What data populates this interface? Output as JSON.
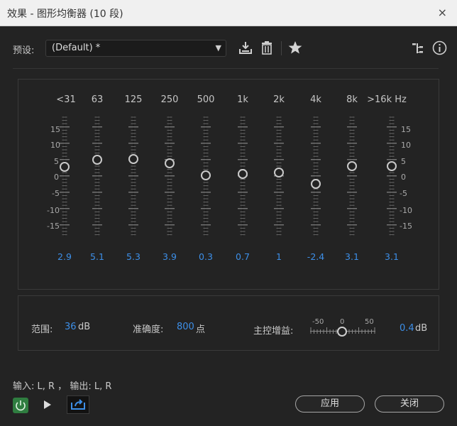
{
  "window": {
    "title": "效果 - 图形均衡器 (10 段)",
    "close_glyph": "×"
  },
  "preset": {
    "label": "预设:",
    "value": "(Default) *"
  },
  "toolbar_icons": [
    "save-preset-icon",
    "delete-icon",
    "favorite-star-icon",
    "routing-icon",
    "info-icon"
  ],
  "eq": {
    "bands": [
      "<31",
      "63",
      "125",
      "250",
      "500",
      "1k",
      "2k",
      "4k",
      "8k",
      ">16k"
    ],
    "unit": "Hz",
    "gains_db": [
      2.9,
      5.1,
      5.3,
      3.9,
      0.3,
      0.7,
      1,
      -2.4,
      3.1,
      3.1
    ],
    "gain_labels": [
      "2.9",
      "5.1",
      "5.3",
      "3.9",
      "0.3",
      "0.7",
      "1",
      "-2.4",
      "3.1",
      "3.1"
    ],
    "scale_labels": [
      "15",
      "10",
      "5",
      "0",
      "-5",
      "-10",
      "-15"
    ]
  },
  "settings": {
    "range_label": "范围:",
    "range_value": "36",
    "range_unit": "dB",
    "accuracy_label": "准确度:",
    "accuracy_value": "800",
    "accuracy_unit": "点",
    "master_label": "主控增益:",
    "master_scale": [
      "-50",
      "0",
      "50"
    ],
    "master_value": "0.4",
    "master_unit": "dB"
  },
  "io": {
    "text": "输入: L, R ， 输出: L, R"
  },
  "buttons": {
    "apply": "应用",
    "close": "关闭"
  }
}
